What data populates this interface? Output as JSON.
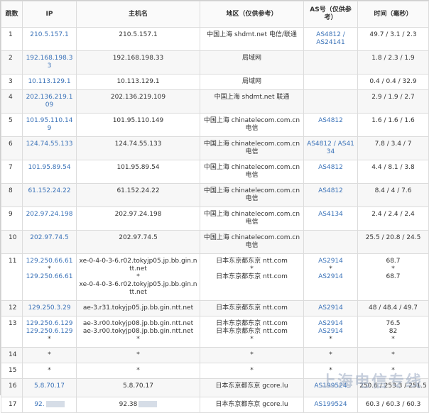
{
  "headers": {
    "hop": "跳数",
    "ip": "IP",
    "host": "主机名",
    "region": "地区（仅供参考）",
    "as": "AS号（仅供参考）",
    "time": "时间（毫秒）"
  },
  "rows": [
    {
      "hop": "1",
      "ip": [
        "210.5.157.1"
      ],
      "host": [
        "210.5.157.1"
      ],
      "region": [
        "中国上海 shdmt.net 电信/联通"
      ],
      "as": [
        "AS4812 /",
        "AS24141"
      ],
      "time": [
        "49.7 / 3.1 / 2.3"
      ]
    },
    {
      "hop": "2",
      "ip": [
        "192.168.198.33"
      ],
      "host": [
        "192.168.198.33"
      ],
      "region": [
        "局域网"
      ],
      "as": [],
      "time": [
        "1.8 / 2.3 / 1.9"
      ]
    },
    {
      "hop": "3",
      "ip": [
        "10.113.129.1"
      ],
      "host": [
        "10.113.129.1"
      ],
      "region": [
        "局域网"
      ],
      "as": [],
      "time": [
        "0.4 / 0.4 / 32.9"
      ]
    },
    {
      "hop": "4",
      "ip": [
        "202.136.219.109"
      ],
      "host": [
        "202.136.219.109"
      ],
      "region": [
        "中国上海 shdmt.net 联通"
      ],
      "as": [],
      "time": [
        "2.9 / 1.9 / 2.7"
      ]
    },
    {
      "hop": "5",
      "ip": [
        "101.95.110.149"
      ],
      "host": [
        "101.95.110.149"
      ],
      "region": [
        "中国上海 chinatelecom.com.cn 电信"
      ],
      "as": [
        "AS4812"
      ],
      "time": [
        "1.6 / 1.6 / 1.6"
      ]
    },
    {
      "hop": "6",
      "ip": [
        "124.74.55.133"
      ],
      "host": [
        "124.74.55.133"
      ],
      "region": [
        "中国上海 chinatelecom.com.cn 电信"
      ],
      "as": [
        "AS4812 / AS4134"
      ],
      "time": [
        "7.8 / 3.4 / 7"
      ]
    },
    {
      "hop": "7",
      "ip": [
        "101.95.89.54"
      ],
      "host": [
        "101.95.89.54"
      ],
      "region": [
        "中国上海 chinatelecom.com.cn 电信"
      ],
      "as": [
        "AS4812"
      ],
      "time": [
        "4.4 / 8.1 / 3.8"
      ]
    },
    {
      "hop": "8",
      "ip": [
        "61.152.24.22"
      ],
      "host": [
        "61.152.24.22"
      ],
      "region": [
        "中国上海 chinatelecom.com.cn 电信"
      ],
      "as": [
        "AS4812"
      ],
      "time": [
        "8.4 / 4 / 7.6"
      ]
    },
    {
      "hop": "9",
      "ip": [
        "202.97.24.198"
      ],
      "host": [
        "202.97.24.198"
      ],
      "region": [
        "中国上海 chinatelecom.com.cn 电信"
      ],
      "as": [
        "AS4134"
      ],
      "time": [
        "2.4 / 2.4 / 2.4"
      ]
    },
    {
      "hop": "10",
      "ip": [
        "202.97.74.5"
      ],
      "host": [
        "202.97.74.5"
      ],
      "region": [
        "中国上海 chinatelecom.com.cn 电信"
      ],
      "as": [],
      "time": [
        "25.5 / 20.8 / 24.5"
      ]
    },
    {
      "hop": "11",
      "ip": [
        "129.250.66.61",
        "*",
        "129.250.66.61"
      ],
      "host": [
        "xe-0-4-0-3-6.r02.tokyjp05.jp.bb.gin.ntt.net",
        "*",
        "xe-0-4-0-3-6.r02.tokyjp05.jp.bb.gin.ntt.net"
      ],
      "region": [
        "日本东京都东京 ntt.com",
        "*",
        "日本东京都东京 ntt.com"
      ],
      "as": [
        "AS2914",
        "*",
        "AS2914"
      ],
      "time": [
        "68.7",
        "*",
        "68.7"
      ]
    },
    {
      "hop": "12",
      "ip": [
        "129.250.3.29"
      ],
      "host": [
        "ae-3.r31.tokyjp05.jp.bb.gin.ntt.net"
      ],
      "region": [
        "日本东京都东京 ntt.com"
      ],
      "as": [
        "AS2914"
      ],
      "time": [
        "48 / 48.4 / 49.7"
      ]
    },
    {
      "hop": "13",
      "ip": [
        "129.250.6.129",
        "129.250.6.129",
        "*"
      ],
      "host": [
        "ae-3.r00.tokyjp08.jp.bb.gin.ntt.net",
        "ae-3.r00.tokyjp08.jp.bb.gin.ntt.net",
        "*"
      ],
      "region": [
        "日本东京都东京 ntt.com",
        "日本东京都东京 ntt.com",
        "*"
      ],
      "as": [
        "AS2914",
        "AS2914",
        "*"
      ],
      "time": [
        "76.5",
        "82",
        "*"
      ]
    },
    {
      "hop": "14",
      "ip": [
        "*"
      ],
      "host": [
        "*"
      ],
      "region": [
        "*"
      ],
      "as": [
        "*"
      ],
      "time": [
        "*"
      ]
    },
    {
      "hop": "15",
      "ip": [
        "*"
      ],
      "host": [
        "*"
      ],
      "region": [
        "*"
      ],
      "as": [
        "*"
      ],
      "time": [
        "*"
      ]
    },
    {
      "hop": "16",
      "ip": [
        "5.8.70.17"
      ],
      "host": [
        "5.8.70.17"
      ],
      "region": [
        "日本东京都东京 gcore.lu"
      ],
      "as": [
        "AS199524"
      ],
      "time": [
        "250.6 / 253.3 / 251.5"
      ]
    },
    {
      "hop": "17",
      "ip": [
        "92."
      ],
      "host": [
        "92.38"
      ],
      "region": [
        "日本东京都东京 gcore.lu"
      ],
      "as": [
        "AS199524"
      ],
      "time": [
        "60.3 / 60.3 / 60.3"
      ],
      "redacted": true
    }
  ],
  "watermark": "上海电信专线"
}
